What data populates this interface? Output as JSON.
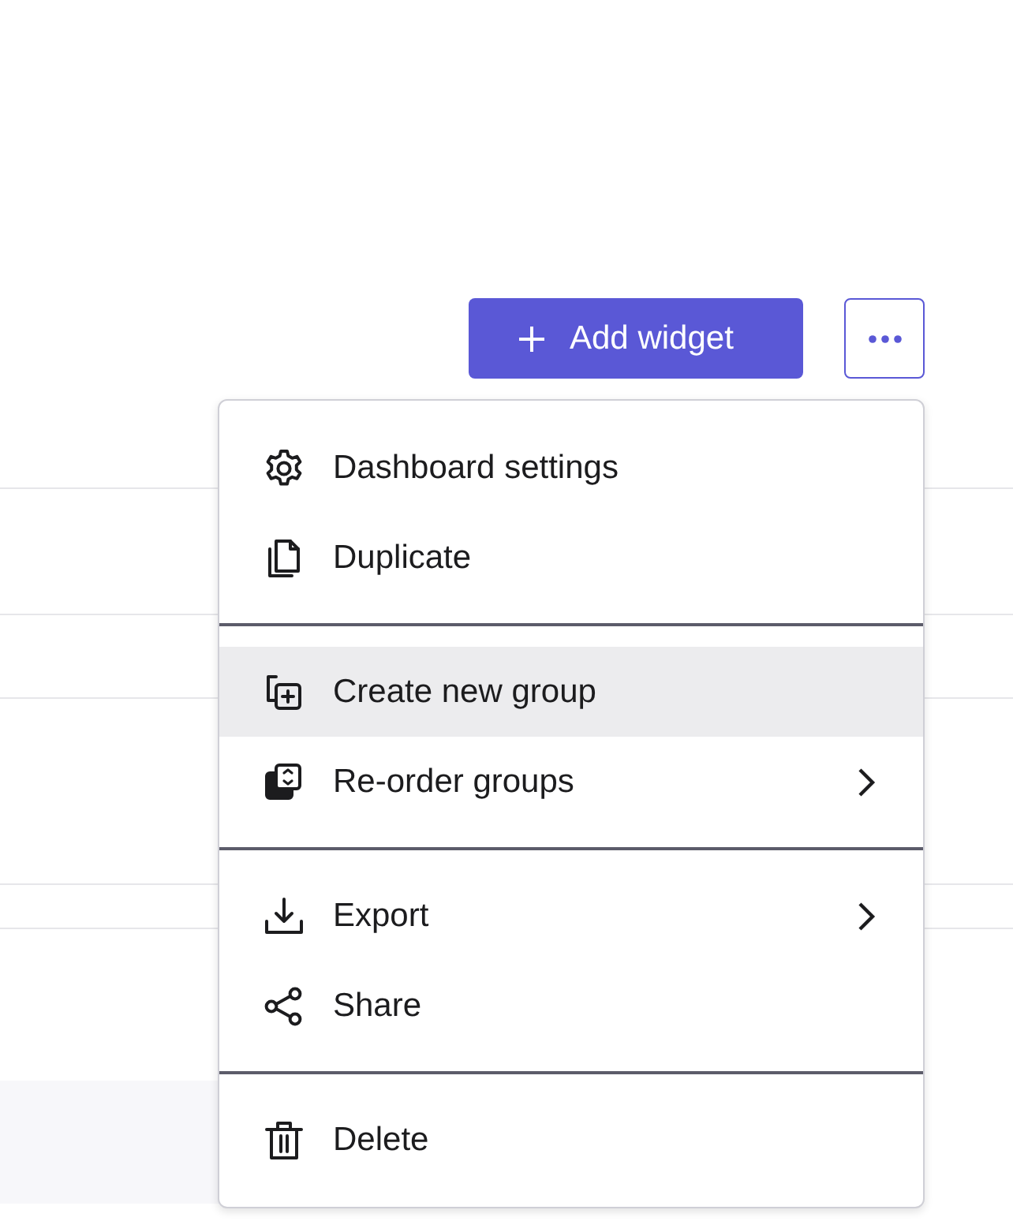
{
  "toolbar": {
    "add_button": {
      "label": "Add widget"
    }
  },
  "menu": {
    "groups": [
      {
        "items": [
          {
            "label": "Dashboard settings",
            "selected": false,
            "submenu": false
          },
          {
            "label": "Duplicate",
            "selected": false,
            "submenu": false
          }
        ]
      },
      {
        "items": [
          {
            "label": "Create new group",
            "selected": true,
            "submenu": false
          },
          {
            "label": "Re-order groups",
            "selected": false,
            "submenu": true
          }
        ]
      },
      {
        "items": [
          {
            "label": "Export",
            "selected": false,
            "submenu": true
          },
          {
            "label": "Share",
            "selected": false,
            "submenu": false
          }
        ]
      },
      {
        "items": [
          {
            "label": "Delete",
            "selected": false,
            "submenu": false
          }
        ]
      }
    ]
  }
}
